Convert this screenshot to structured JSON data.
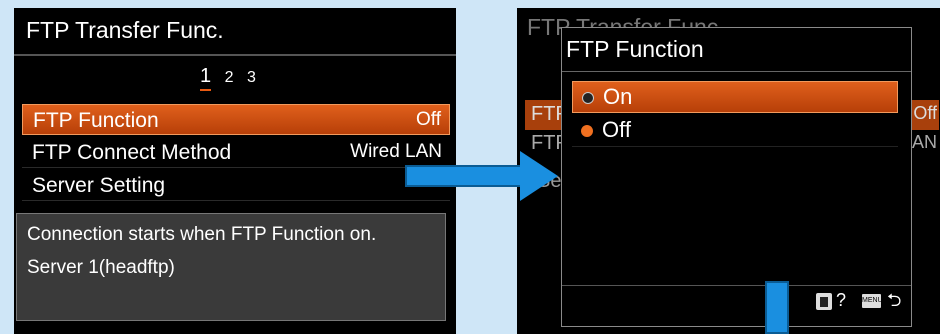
{
  "left_screen": {
    "title": "FTP Transfer Func.",
    "pages": [
      "1",
      "2",
      "3"
    ],
    "menu_items": [
      {
        "label": "FTP Function",
        "value": "Off"
      },
      {
        "label": "FTP Connect Method",
        "value": "Wired LAN"
      },
      {
        "label": "Server Setting",
        "value": ""
      }
    ],
    "help_lines": [
      "Connection starts when FTP Function on.",
      "Server 1(headftp)"
    ]
  },
  "right_screen": {
    "background_title": "FTP Transfer Func.",
    "background_row_fragments": [
      "FTP",
      "Off",
      "FTP",
      "AN",
      "Ser"
    ],
    "dialog": {
      "title": "FTP Function",
      "options": [
        {
          "label": "On",
          "selected": true
        },
        {
          "label": "Off",
          "selected": false
        }
      ],
      "footer": {
        "help_symbol": "?",
        "menu_key_label": "MENU",
        "back_symbol": "⮌"
      }
    }
  },
  "icons": [
    "trash-icon",
    "help-icon",
    "menu-key-icon",
    "back-icon",
    "arrow-right-icon",
    "arrow-down-icon"
  ],
  "colors": {
    "page_background": "#cfe6f7",
    "highlight_orange": "#d4531a",
    "arrow_blue": "#1a8fe0"
  }
}
